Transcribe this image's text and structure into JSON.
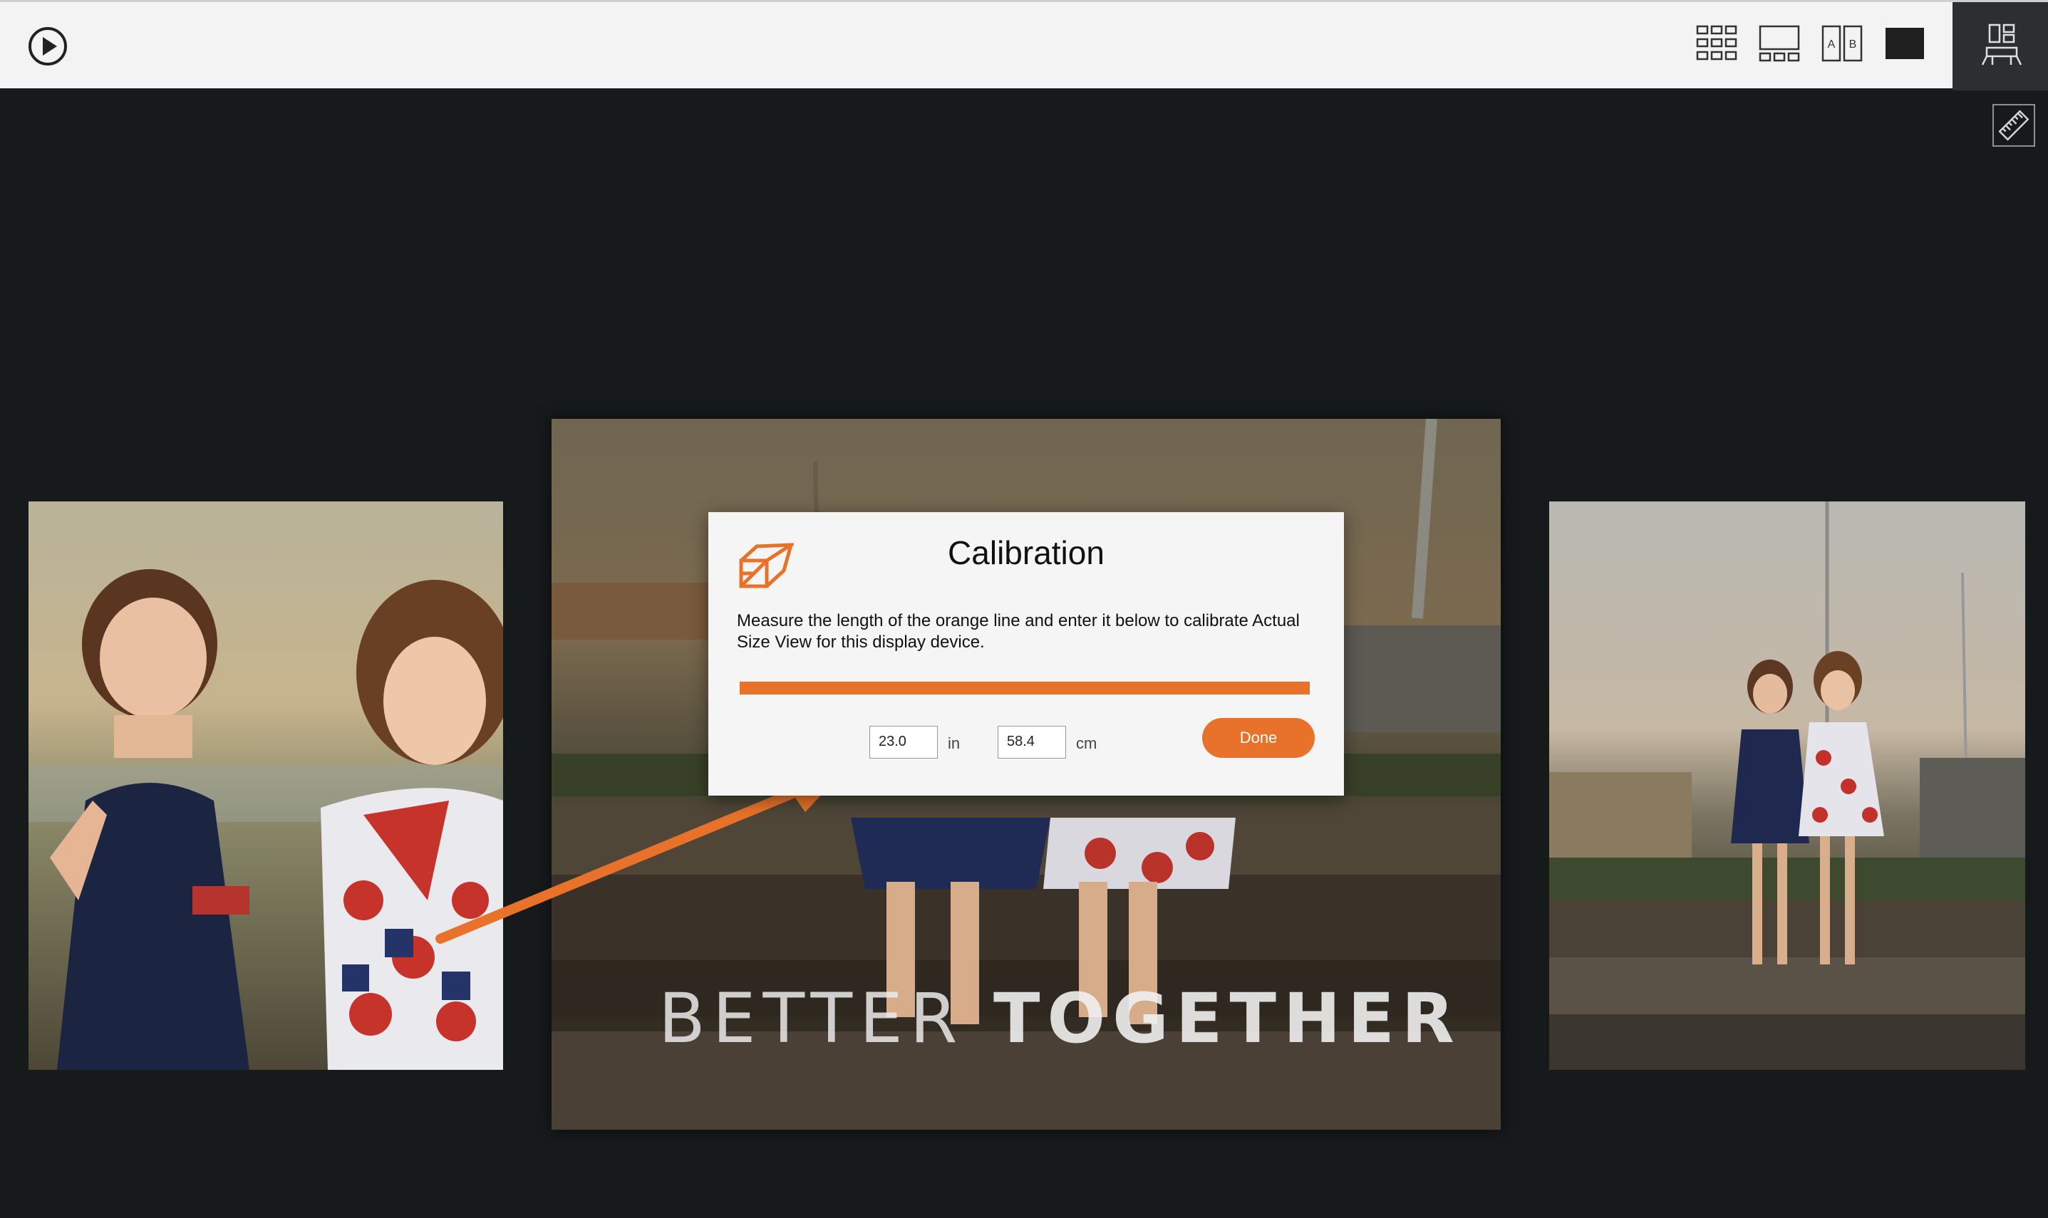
{
  "toolbar": {
    "play": "play-icon",
    "views": [
      "grid-view-icon",
      "loupe-filmstrip-view-icon",
      "compare-ab-view-icon",
      "single-view-icon"
    ],
    "panel": "side-panel-icon",
    "ruler": "ruler-icon"
  },
  "slideshow": {
    "headline_word1": "BETTER",
    "headline_word2": "TOGETHER"
  },
  "dialog": {
    "title": "Calibration",
    "message": "Measure the length of the orange line and enter it below to calibrate Actual Size View for this display device.",
    "inches_value": "23.0",
    "inches_unit": "in",
    "cm_value": "58.4",
    "cm_unit": "cm",
    "done_label": "Done",
    "accent": "#e8722a"
  }
}
